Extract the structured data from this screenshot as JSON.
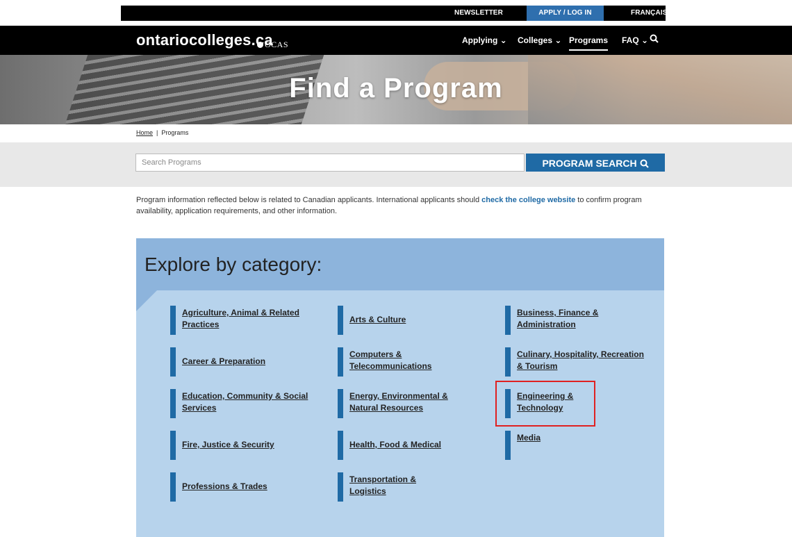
{
  "utility": {
    "newsletter": "NEWSLETTER",
    "apply": "APPLY / LOG IN",
    "francais": "FRANÇAIS"
  },
  "nav": {
    "logo": "ontariocolleges.ca",
    "logo_sub": "OCAS",
    "applying": "Applying",
    "colleges": "Colleges",
    "programs": "Programs",
    "faq": "FAQ"
  },
  "hero": {
    "title": "Find a Program"
  },
  "breadcrumb": {
    "home": "Home",
    "sep": "|",
    "current": "Programs"
  },
  "search": {
    "placeholder": "Search Programs",
    "button": "PROGRAM SEARCH"
  },
  "info": {
    "before": "Program information reflected below is related to Canadian applicants. International applicants should ",
    "link": "check the college website",
    "after": " to confirm program availability, application requirements, and other information."
  },
  "categories": {
    "title": "Explore by category:",
    "items": [
      "Agriculture, Animal & Related Practices",
      "Arts & Culture",
      "Business, Finance & Administration",
      "Career & Preparation",
      "Computers & Telecommunications",
      "Culinary, Hospitality, Recreation & Tourism",
      "Education, Community & Social Services",
      "Energy, Environmental & Natural Resources",
      "Engineering & Technology",
      "Fire, Justice & Security",
      "Health, Food & Medical",
      "Media",
      "Professions & Trades",
      "Transportation & Logistics"
    ]
  },
  "colors": {
    "accent": "#1f6aa5",
    "panel": "#b7d3ec",
    "panel_header": "#8db4dc",
    "highlight": "#e02020"
  }
}
